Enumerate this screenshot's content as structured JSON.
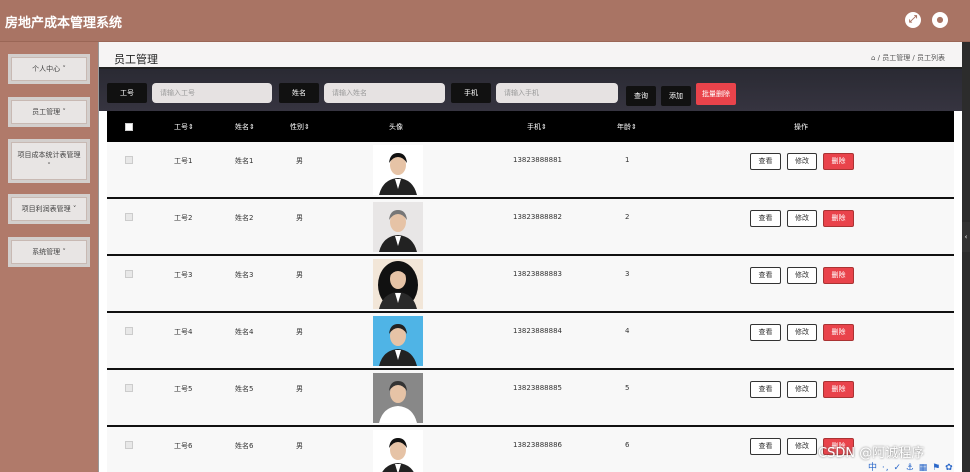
{
  "app": {
    "title": "房地产成本管理系统"
  },
  "topbar": {
    "fullscreen_icon": "⤢",
    "user_icon": "👤"
  },
  "sidebar": {
    "items": [
      {
        "label": "个人中心 ˅"
      },
      {
        "label": "员工管理 ˅"
      },
      {
        "label": "项目成本统计表管理 ˅"
      },
      {
        "label": "项目利润表管理 ˅"
      },
      {
        "label": "系统管理 ˅"
      }
    ]
  },
  "header": {
    "title": "员工管理",
    "breadcrumb": "⌂ / 员工管理 / 员工列表"
  },
  "filters": {
    "id_label": "工号",
    "id_placeholder": "请输入工号",
    "name_label": "姓名",
    "name_placeholder": "请输入姓名",
    "phone_label": "手机",
    "phone_placeholder": "请输入手机",
    "search": "查询",
    "add": "添加",
    "batch_delete": "批量删除"
  },
  "table": {
    "headers": {
      "id": "工号⇕",
      "name": "姓名⇕",
      "gender": "性别⇕",
      "avatar": "头像",
      "phone": "手机⇕",
      "age": "年龄⇕",
      "ops": "操作"
    },
    "actions": {
      "view": "查看",
      "edit": "修改",
      "delete": "删除"
    },
    "rows": [
      {
        "id": "工号1",
        "name": "姓名1",
        "gender": "男",
        "phone": "13823888881",
        "age": "1"
      },
      {
        "id": "工号2",
        "name": "姓名2",
        "gender": "男",
        "phone": "13823888882",
        "age": "2"
      },
      {
        "id": "工号3",
        "name": "姓名3",
        "gender": "男",
        "phone": "13823888883",
        "age": "3"
      },
      {
        "id": "工号4",
        "name": "姓名4",
        "gender": "男",
        "phone": "13823888884",
        "age": "4"
      },
      {
        "id": "工号5",
        "name": "姓名5",
        "gender": "男",
        "phone": "13823888885",
        "age": "5"
      },
      {
        "id": "工号6",
        "name": "姓名6",
        "gender": "男",
        "phone": "13823888886",
        "age": "6"
      }
    ]
  },
  "watermark": "CSDN @阿诚程序",
  "toolstrip": "中 ·, ✓ ⚓ ▦ ⚑ ✿",
  "colors": {
    "brand": "#a97464",
    "danger": "#e9434b",
    "header_bg": "#000000"
  }
}
